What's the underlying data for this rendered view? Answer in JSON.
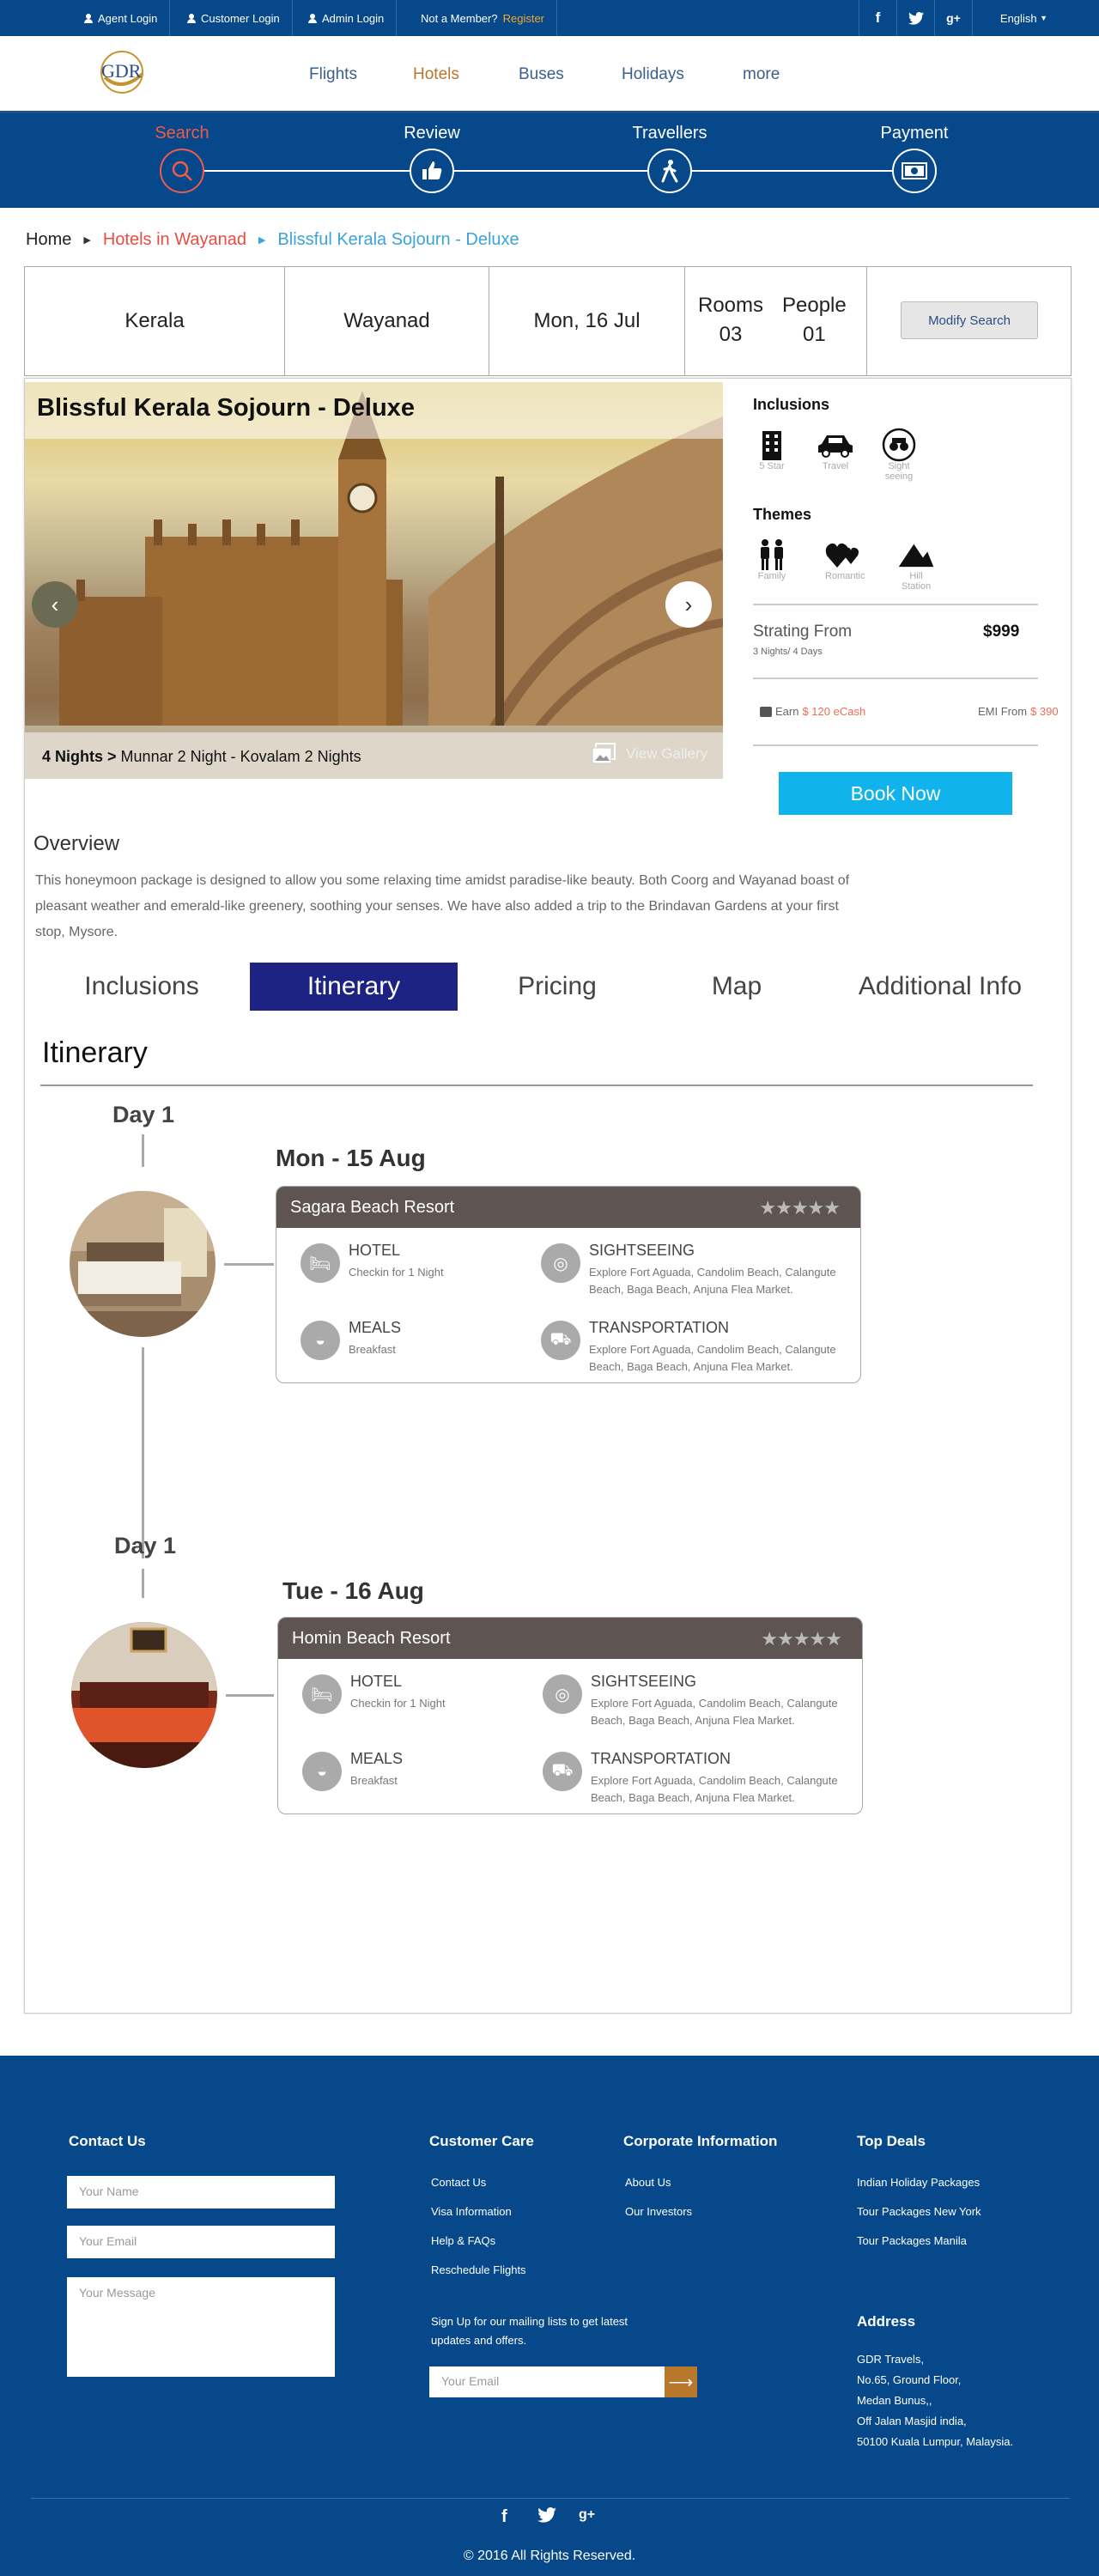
{
  "topbar": {
    "agent_login": "Agent Login",
    "customer_login": "Customer Login",
    "admin_login": "Admin Login",
    "not_member": "Not a Member?",
    "register": "Register",
    "language": "English"
  },
  "header": {
    "logo_text": "GDR",
    "nav": [
      "Flights",
      "Hotels",
      "Buses",
      "Holidays",
      "more"
    ],
    "active_nav": "Hotels"
  },
  "steps": [
    "Search",
    "Review",
    "Travellers",
    "Payment"
  ],
  "breadcrumb": [
    "Home",
    "Hotels in Wayanad",
    "Blissful Kerala Sojourn - Deluxe"
  ],
  "summary": {
    "state": "Kerala",
    "city": "Wayanad",
    "date": "Mon, 16 Jul",
    "rooms_label": "Rooms",
    "rooms_value": "03",
    "people_label": "People",
    "people_value": "01",
    "modify": "Modify Search"
  },
  "package": {
    "title": "Blissful Kerala Sojourn - Deluxe",
    "nights_bold": "4 Nights >",
    "nights_detail": "Munnar 2 Night - Kovalam 2 Nights",
    "view_gallery": "View Gallery",
    "inclusions_title": "Inclusions",
    "inclusions": [
      "5 Star",
      "Travel",
      "Sight seeing"
    ],
    "themes_title": "Themes",
    "themes": [
      "Family",
      "Romantic",
      "Hill Station"
    ],
    "starting_from": "Strating From",
    "price": "$999",
    "duration": "3 Nights/ 4 Days",
    "earn_label": "Earn",
    "earn_value": "$ 120 eCash",
    "emi_label": "EMI From",
    "emi_value": "$ 390",
    "book_now": "Book Now"
  },
  "overview": {
    "title": "Overview",
    "text": "This honeymoon package is designed to allow you some relaxing time amidst paradise-like beauty. Both Coorg and Wayanad boast of pleasant weather and emerald-like greenery, soothing your senses. We have also added a trip to the Brindavan Gardens at your first stop, Mysore."
  },
  "tabs": [
    "Inclusions",
    "Itinerary",
    "Pricing",
    "Map",
    "Additional Info"
  ],
  "active_tab": "Itinerary",
  "itinerary": {
    "title": "Itinerary",
    "days": [
      {
        "label": "Day 1",
        "date": "Mon - 15 Aug",
        "hotel": "Sagara Beach Resort",
        "stars": "★★★★★",
        "hotel_title": "HOTEL",
        "hotel_desc": "Checkin for 1 Night",
        "meals_title": "MEALS",
        "meals_desc": "Breakfast",
        "sight_title": "SIGHTSEEING",
        "sight_desc": "Explore Fort Aguada, Candolim Beach, Calangute Beach, Baga Beach, Anjuna Flea Market.",
        "transport_title": "TRANSPORTATION",
        "transport_desc": "Explore Fort Aguada, Candolim Beach, Calangute Beach, Baga Beach, Anjuna Flea Market."
      },
      {
        "label": "Day 1",
        "date": "Tue - 16 Aug",
        "hotel": "Homin Beach Resort",
        "stars": "★★★★★",
        "hotel_title": "HOTEL",
        "hotel_desc": "Checkin for 1 Night",
        "meals_title": "MEALS",
        "meals_desc": "Breakfast",
        "sight_title": "SIGHTSEEING",
        "sight_desc": "Explore Fort Aguada, Candolim Beach, Calangute Beach, Baga Beach, Anjuna Flea Market.",
        "transport_title": "TRANSPORTATION",
        "transport_desc": "Explore Fort Aguada, Candolim Beach, Calangute Beach, Baga Beach, Anjuna Flea Market."
      }
    ]
  },
  "footer": {
    "contact_title": "Contact Us",
    "name_placeholder": "Your Name",
    "email_placeholder": "Your Email",
    "message_placeholder": "Your Message",
    "care_title": "Customer Care",
    "care_links": [
      "Contact Us",
      "Visa Information",
      "Help & FAQs",
      "Reschedule Flights"
    ],
    "corp_title": "Corporate Information",
    "corp_links": [
      "About Us",
      "Our Investors"
    ],
    "deals_title": "Top Deals",
    "deals_links": [
      "Indian Holiday Packages",
      "Tour Packages New York",
      "Tour Packages Manila"
    ],
    "signup_line1": "Sign Up for our mailing lists to get latest",
    "signup_line2": "updates and offers.",
    "subscribe_placeholder": "Your Email",
    "address_title": "Address",
    "address_lines": [
      "GDR Travels,",
      "No.65, Ground Floor,",
      "Medan Bunus,,",
      "Off Jalan Masjid india,",
      "50100 Kuala Lumpur, Malaysia."
    ],
    "copyright": "© 2016 All Rights Reserved."
  },
  "colors": {
    "brand_blue": "#06488a",
    "accent_orange": "#b8782c",
    "step_active": "#f05b4a",
    "tab_active": "#1c2383",
    "book_button": "#11b3ec"
  }
}
